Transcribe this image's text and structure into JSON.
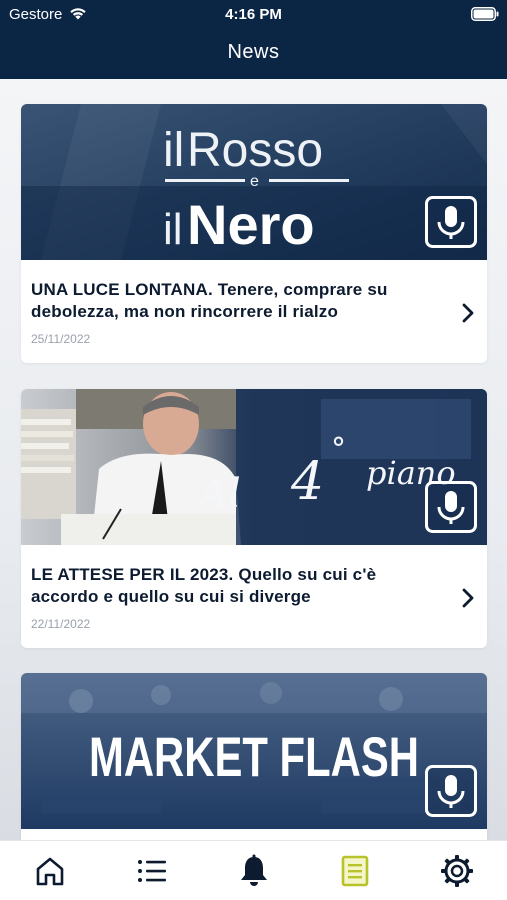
{
  "status_bar": {
    "carrier": "Gestore",
    "time": "4:16 PM"
  },
  "header": {
    "title": "News"
  },
  "articles": [
    {
      "title": "UNA LUCE LONTANA. Tenere, comprare su debolezza, ma non rincorrere il rialzo",
      "date": "25/11/2022",
      "banner_text": [
        "il",
        "Rosso",
        "e",
        "il",
        "Nero"
      ],
      "has_audio": true
    },
    {
      "title": "LE ATTESE PER IL 2023. Quello su cui c'è accordo e quello su cui si diverge",
      "date": "22/11/2022",
      "banner_text": [
        "Al",
        "4",
        "°",
        "piano"
      ],
      "has_audio": true
    },
    {
      "title": "",
      "date": "",
      "banner_text": [
        "MARKET FLASH"
      ],
      "has_audio": true
    }
  ],
  "tabs": [
    {
      "icon": "home-icon",
      "active": false
    },
    {
      "icon": "list-icon",
      "active": false
    },
    {
      "icon": "bell-icon",
      "active": false
    },
    {
      "icon": "news-icon",
      "active": true
    },
    {
      "icon": "settings-icon",
      "active": false
    }
  ],
  "colors": {
    "header_bg": "#0b2545",
    "active_tab": "#b8c22a",
    "inactive_tab": "#0d1b30",
    "date_text": "#9aa1ab"
  }
}
